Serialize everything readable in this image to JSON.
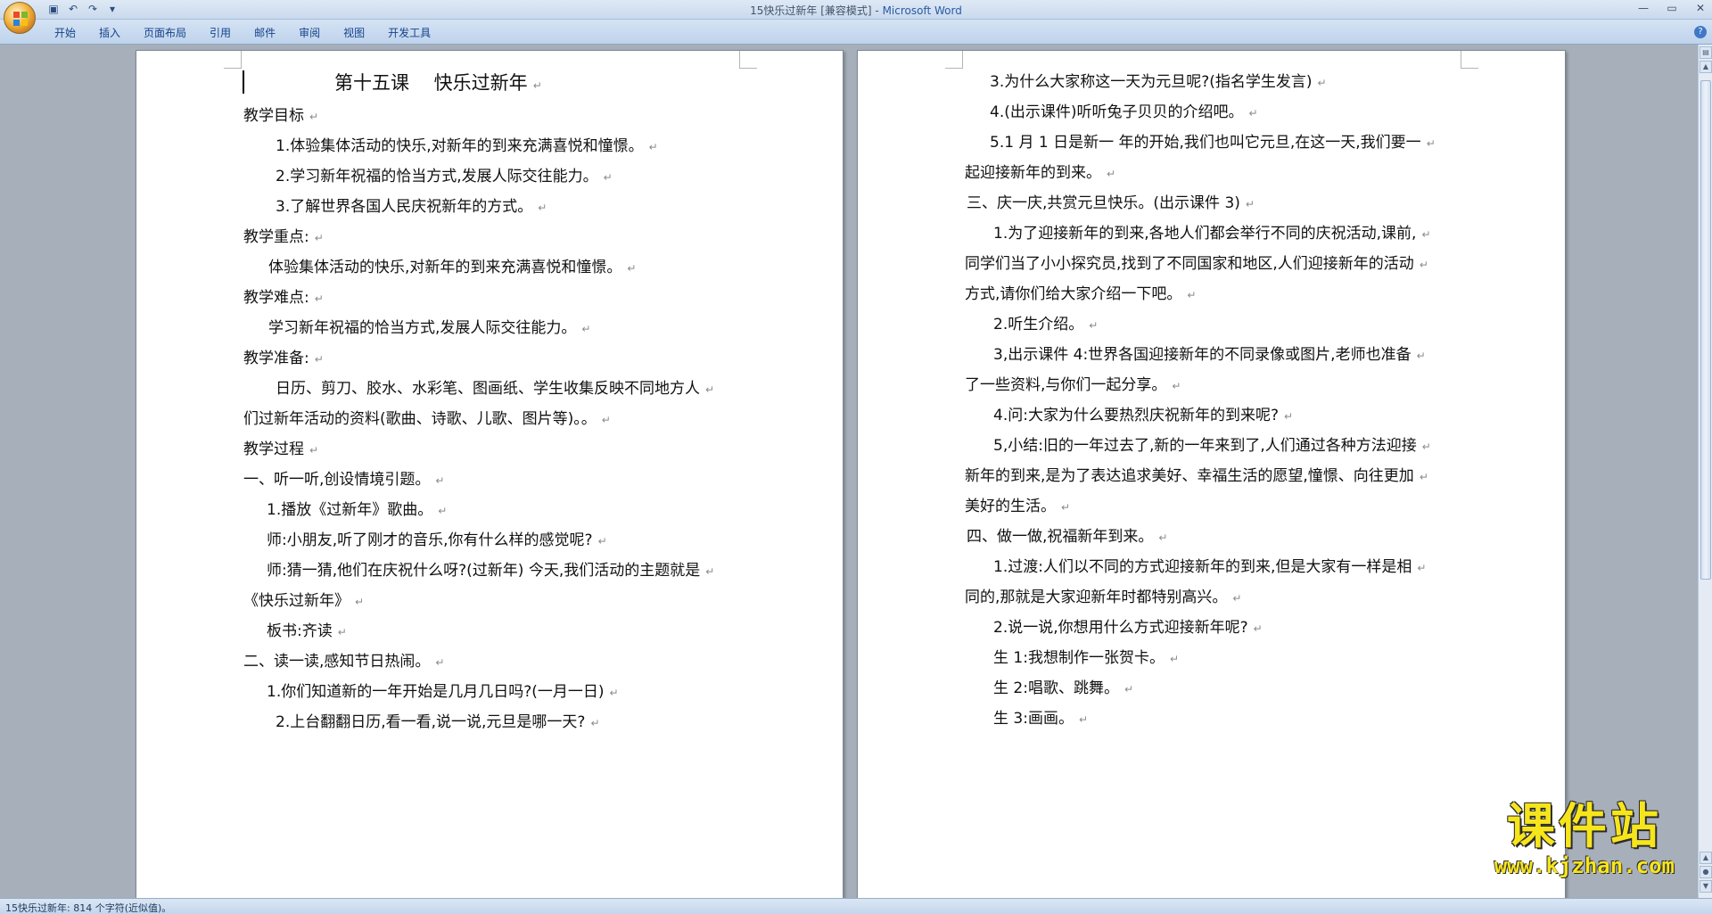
{
  "window": {
    "title_doc": "15快乐过新年 [兼容模式]",
    "title_sep": " - ",
    "title_app": "Microsoft Word"
  },
  "ribbon": {
    "tabs": [
      "开始",
      "插入",
      "页面布局",
      "引用",
      "邮件",
      "审阅",
      "视图",
      "开发工具"
    ]
  },
  "pages": {
    "left": [
      "第十五课　 快乐过新年",
      "教学目标",
      "1.体验集体活动的快乐,对新年的到来充满喜悦和憧憬。",
      "2.学习新年祝福的恰当方式,发展人际交往能力。",
      "3.了解世界各国人民庆祝新年的方式。",
      "教学重点:",
      "体验集体活动的快乐,对新年的到来充满喜悦和憧憬。",
      "教学难点:",
      "学习新年祝福的恰当方式,发展人际交往能力。",
      "教学准备:",
      "日历、剪刀、胶水、水彩笔、图画纸、学生收集反映不同地方人",
      "们过新年活动的资料(歌曲、诗歌、儿歌、图片等)。。",
      "教学过程",
      "一、听一听,创设情境引题。",
      "1.播放《过新年》歌曲。",
      "师:小朋友,听了刚才的音乐,你有什么样的感觉呢?",
      "师:猜一猜,他们在庆祝什么呀?(过新年) 今天,我们活动的主题就是",
      "《快乐过新年》",
      "板书:齐读",
      "二、读一读,感知节日热闹。",
      "1.你们知道新的一年开始是几月几日吗?(一月一日)",
      "2.上台翻翻日历,看一看,说一说,元旦是哪一天?"
    ],
    "right": [
      "3.为什么大家称这一天为元旦呢?(指名学生发言)",
      "4.(出示课件)听听兔子贝贝的介绍吧。",
      "5.1 月 1 日是新一 年的开始,我们也叫它元旦,在这一天,我们要一",
      "起迎接新年的到来。",
      "三、庆一庆,共赏元旦快乐。(出示课件 3)",
      "1.为了迎接新年的到来,各地人们都会举行不同的庆祝活动,课前,",
      "同学们当了小小探究员,找到了不同国家和地区,人们迎接新年的活动",
      "方式,请你们给大家介绍一下吧。",
      "2.听生介绍。",
      "3,出示课件 4:世界各国迎接新年的不同录像或图片,老师也准备",
      "了一些资料,与你们一起分享。",
      "4.问:大家为什么要热烈庆祝新年的到来呢?",
      "5,小结:旧的一年过去了,新的一年来到了,人们通过各种方法迎接",
      "新年的到来,是为了表达追求美好、幸福生活的愿望,憧憬、向往更加",
      "美好的生活。",
      "四、做一做,祝福新年到来。",
      "1.过渡:人们以不同的方式迎接新年的到来,但是大家有一样是相",
      "同的,那就是大家迎新年时都特别高兴。",
      "2.说一说,你想用什么方式迎接新年呢?",
      "生 1:我想制作一张贺卡。",
      "生 2:唱歌、跳舞。",
      "生 3:画画。"
    ]
  },
  "status": {
    "text": "15快乐过新年: 814 个字符(近似值)。"
  },
  "watermark": {
    "name": "课件站",
    "url": "www.kjzhan.com"
  },
  "colors": {
    "title_app": "#2a5aa4",
    "ribbon_tab": "#15428b",
    "watermark": "#f7e51c"
  }
}
